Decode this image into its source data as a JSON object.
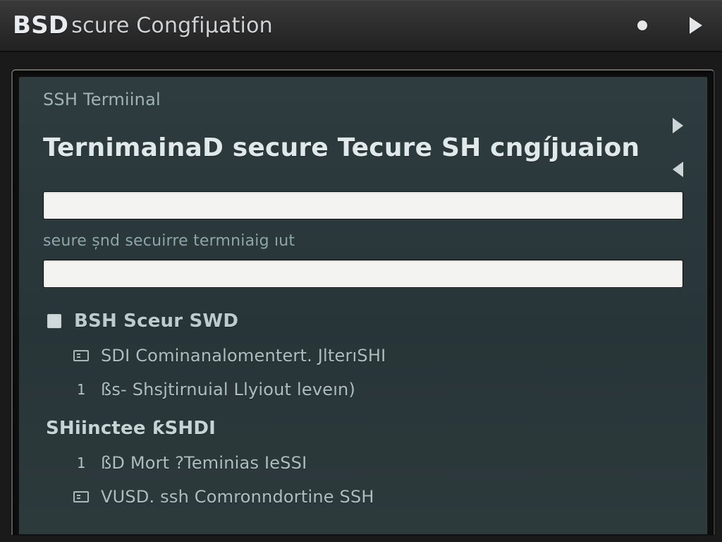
{
  "titlebar": {
    "title_primary": "BSD",
    "title_secondary": "scure Congfiµation"
  },
  "panel": {
    "eyebrow": "SSH Termiinal",
    "heading": "TernimainaD secure Tecure SH cngíjuaion",
    "input1_value": "",
    "label1": "seure șnd secuirre termniaig ıut",
    "input2_value": ""
  },
  "options": {
    "main": {
      "label": "BSH Sceur SWD"
    },
    "sub_items": [
      {
        "icon": "cmd",
        "label": "SDI Cominanalomentert. JlterıSHI"
      },
      {
        "icon": "num1",
        "label": "ßs- Shsjtirnuial Llyiout leveın)"
      }
    ],
    "section2": {
      "label": "SHiinctee ƙSHDI"
    },
    "sub_items2": [
      {
        "icon": "num1",
        "label": "ßD Mort ?Teminias IeSSI"
      },
      {
        "icon": "cmd",
        "label": "VUSD. ssh Comronndortine SSH"
      }
    ]
  }
}
